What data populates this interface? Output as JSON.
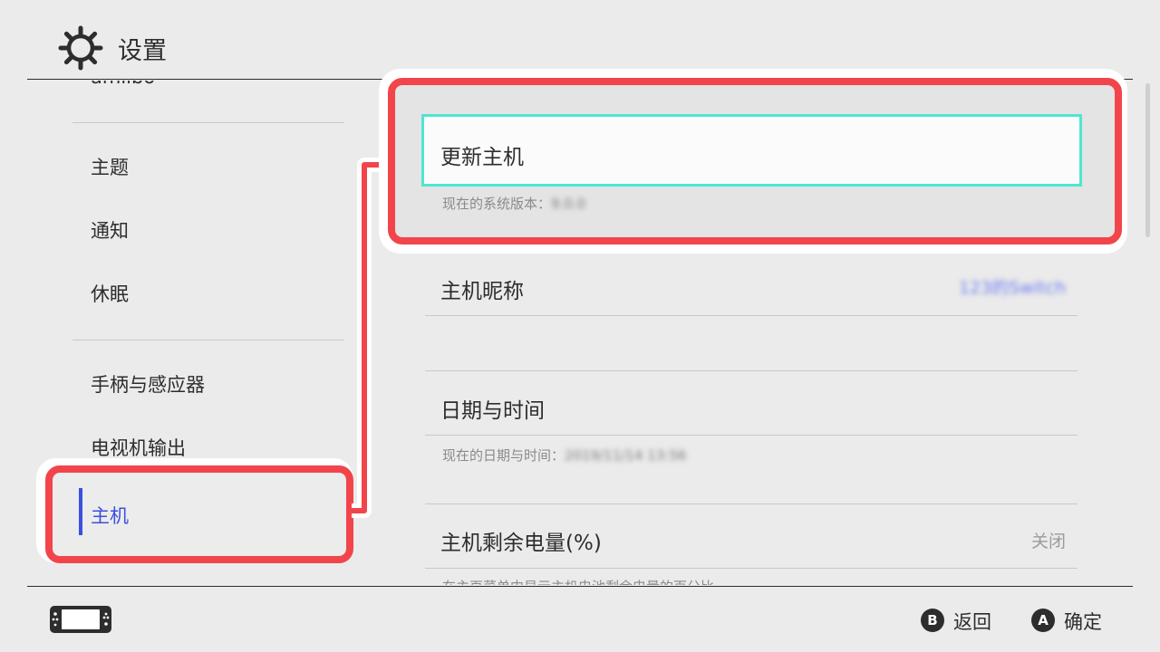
{
  "header": {
    "title": "设置"
  },
  "sidebar": {
    "partial_item": "amiibo",
    "items": [
      "主题",
      "通知",
      "休眠",
      "手柄与感应器",
      "电视机输出",
      "主机"
    ],
    "selected_index": 5
  },
  "content": {
    "update": {
      "title": "更新主机",
      "subtitle_prefix": "现在的系统版本：",
      "version": "9.0.0"
    },
    "nickname": {
      "title": "主机昵称",
      "value": "123的Switch"
    },
    "datetime": {
      "title": "日期与时间",
      "subtitle_prefix": "现在的日期与时间：",
      "value": "2019/11/14 13:56"
    },
    "battery": {
      "title": "主机剩余电量(%)",
      "value": "关闭",
      "subtitle": "在主页菜单中显示主机电池剩余电量的百分比"
    }
  },
  "footer": {
    "back": {
      "key": "B",
      "label": "返回"
    },
    "confirm": {
      "key": "A",
      "label": "确定"
    }
  },
  "colors": {
    "highlight_red": "#f2454b",
    "selection_cyan": "#4fe6d3",
    "accent_blue": "#3b4fe0"
  },
  "icons": {
    "header": "gear-icon",
    "footer": "console-icon"
  }
}
